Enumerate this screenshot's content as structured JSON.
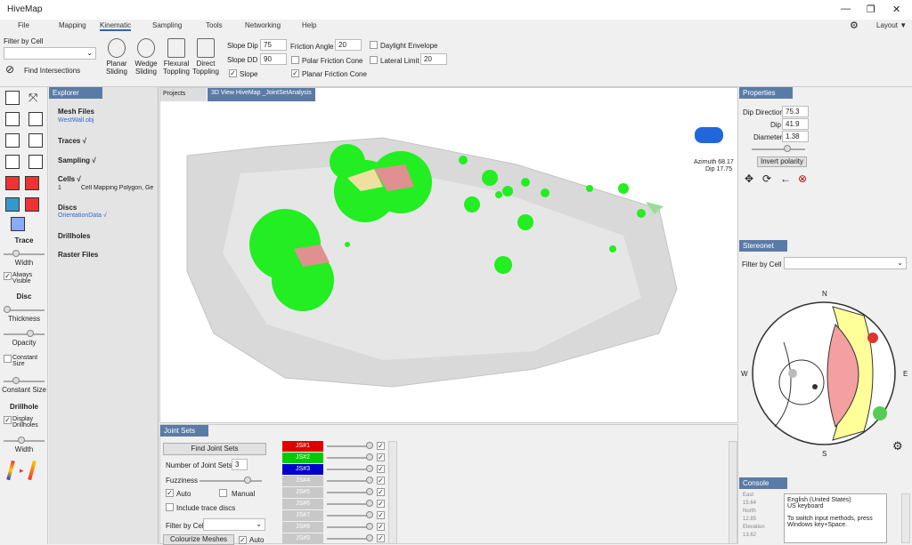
{
  "app": {
    "title": "HiveMap"
  },
  "menu": [
    "File",
    "Mapping",
    "Kinematic",
    "Sampling",
    "Tools",
    "Networking",
    "Help"
  ],
  "layout_label": "Layout",
  "ribbon": {
    "filter_by_cell": "Filter by Cell",
    "find_intersections": "Find Intersections",
    "tools": [
      {
        "label": "Planar Sliding"
      },
      {
        "label": "Wedge Sliding"
      },
      {
        "label": "Flexural Toppling"
      },
      {
        "label": "Direct Toppling"
      }
    ],
    "slope_dip_label": "Slope Dip",
    "slope_dip": "75",
    "slope_dd_label": "Slope DD",
    "slope_dd": "90",
    "slope_cb": "Slope",
    "friction_angle_label": "Friction Angle",
    "friction_angle": "20",
    "polar_friction_cone": "Polar Friction Cone",
    "planar_friction_cone": "Planar Friction Cone",
    "daylight_envelope": "Daylight Envelope",
    "lateral_limit_label": "Lateral Limit",
    "lateral_limit": "20"
  },
  "left": {
    "trace": "Trace",
    "width": "Width",
    "always_visible": "Always Visible",
    "disc": "Disc",
    "thickness": "Thickness",
    "opacity": "Opacity",
    "constant_size_cb": "Constant Size",
    "constant_size": "Constant Size",
    "drillhole": "Drillhole",
    "display_drillholes": "Display Drillholes",
    "width2": "Width"
  },
  "explorer": {
    "title": "Explorer",
    "mesh_files": "Mesh Files",
    "mesh_file": "WestWall.obj",
    "traces": "Traces √",
    "sampling": "Sampling √",
    "cells": "Cells √",
    "cell_num": "1",
    "cell_item": "Cell Mapping Polygon, Ge",
    "discs": "Discs",
    "discs_item": "OrientationData √",
    "drillholes": "Drillholes",
    "raster": "Raster Files"
  },
  "view": {
    "tab_projects": "Projects",
    "tab_3d": "3D View HiveMap _JointSetAnalysis",
    "azimuth": "Azimuth 68.17",
    "dip": "Dip 17.75"
  },
  "joint": {
    "title": "Joint Sets",
    "find": "Find Joint Sets",
    "num_label": "Number of Joint Sets",
    "num": "3",
    "fuzziness": "Fuzziness",
    "auto": "Auto",
    "manual": "Manual",
    "include": "Include trace discs",
    "filter": "Filter by Cell",
    "colorize": "Colourize Meshes",
    "auto2": "Auto",
    "sets": [
      {
        "name": "JS#1",
        "color": "#e00000"
      },
      {
        "name": "JS#2",
        "color": "#00cc00"
      },
      {
        "name": "JS#3",
        "color": "#0000cc"
      },
      {
        "name": "JS#4",
        "color": "#c8c8c8"
      },
      {
        "name": "JS#5",
        "color": "#c8c8c8"
      },
      {
        "name": "JS#6",
        "color": "#c8c8c8"
      },
      {
        "name": "JS#7",
        "color": "#c8c8c8"
      },
      {
        "name": "JS#8",
        "color": "#c8c8c8"
      },
      {
        "name": "JS#9",
        "color": "#c8c8c8"
      }
    ]
  },
  "properties": {
    "title": "Properties",
    "dip_dir_label": "Dip Direction",
    "dip_dir": "75.3",
    "dip_label": "Dip",
    "dip": "41.9",
    "diam_label": "Diameter",
    "diam": "1.38",
    "invert": "Invert polarity"
  },
  "stereonet": {
    "title": "Stereonet",
    "filter": "Filter by Cell",
    "N": "N",
    "S": "S",
    "E": "E",
    "W": "W"
  },
  "console": {
    "title": "Console",
    "lines": [
      "East",
      "15.64",
      "North",
      "12.85",
      "Elevation",
      "13.62"
    ],
    "ime": "English (United States)\nUS keyboard\n\nTo switch input methods, press Windows key+Space."
  }
}
